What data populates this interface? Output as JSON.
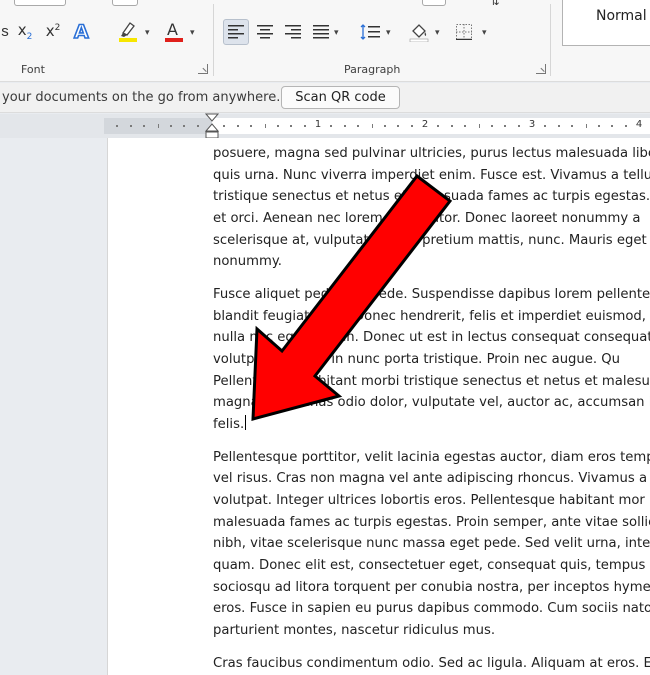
{
  "ribbon": {
    "font_group": {
      "label": "Font",
      "buttons": [
        {
          "name": "subscript-button",
          "label": "x₂"
        },
        {
          "name": "superscript-button",
          "label": "x²"
        },
        {
          "name": "text-effects-button",
          "label": "A"
        },
        {
          "name": "font-color-button",
          "label": "A"
        }
      ],
      "highlight_color": "#f7e600",
      "font_color": "#e0201b",
      "effects_color": "#2a6fd6"
    },
    "paragraph_group": {
      "label": "Paragraph"
    },
    "styles_group": {
      "normal_label": "Normal"
    }
  },
  "notice_bar": {
    "message": "your documents on the go from anywhere.",
    "qr_button_label": "Scan QR code"
  },
  "ruler": {
    "numbers": [
      "1",
      "2",
      "3",
      "4"
    ]
  },
  "document": {
    "paragraphs": [
      [
        "posuere, magna sed pulvinar ultricies, purus lectus malesuada libe",
        "quis urna. Nunc viverra imperdiet enim. Fusce est. Vivamus a tellu",
        "tristique senectus et netus et malesuada fames ac turpis egestas.",
        "et orci. Aenean nec lorem in porttitor. Donec laoreet nonummy a",
        "scelerisque at, vulputate vitae, pretium mattis, nunc. Mauris eget",
        "nonummy."
      ],
      [
        "Fusce aliquet pede non pede. Suspendisse dapibus lorem pellente",
        "blandit feugiat nulla. Donec hendrerit, felis et imperdiet euismod,",
        "nulla nec eget sapien. Donec ut est in lectus consequat consequat.",
        "volutpat at lorem in nunc porta tristique. Proin nec augue. Qu",
        "Pellentesque habitant morbi tristique senectus et netus et malesu",
        "magna. Maecenas odio dolor, vulputate vel, auctor ac, accumsan i",
        "felis."
      ],
      [
        "Pellentesque porttitor, velit lacinia egestas auctor, diam eros temp",
        "vel risus. Cras non magna vel ante adipiscing rhoncus. Vivamus a r",
        "volutpat. Integer ultrices lobortis eros. Pellentesque habitant mor",
        "malesuada fames ac turpis egestas. Proin semper, ante vitae sollic",
        "nibh, vitae scelerisque nunc massa eget pede. Sed velit urna, inter",
        "quam. Donec elit est, consectetuer eget, consequat quis, tempus c",
        "sociosqu ad litora torquent per conubia nostra, per inceptos hyme",
        "eros. Fusce in sapien eu purus dapibus commodo. Cum sociis nato",
        "parturient montes, nascetur ridiculus mus."
      ],
      [
        "Cras faucibus condimentum odio. Sed ac ligula. Aliquam at eros. E"
      ]
    ]
  },
  "annotation": {
    "arrow_color": "#ff0000",
    "arrow_outline_color": "#000000"
  }
}
